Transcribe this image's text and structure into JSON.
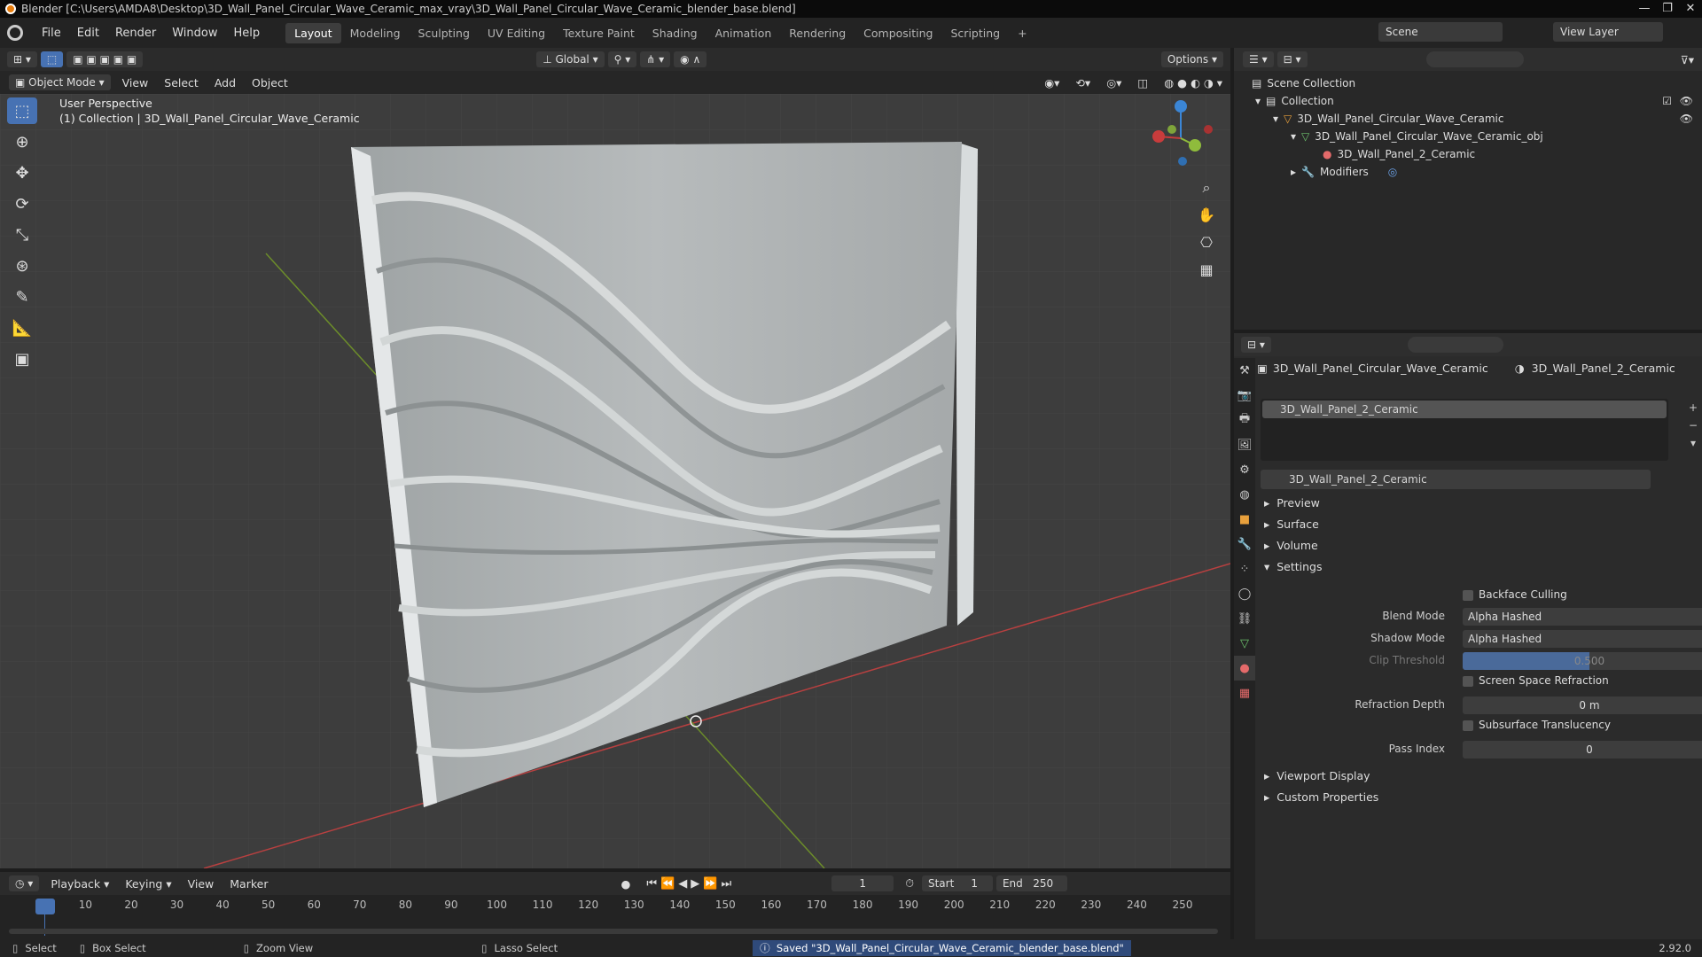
{
  "title": "Blender [C:\\Users\\AMDA8\\Desktop\\3D_Wall_Panel_Circular_Wave_Ceramic_max_vray\\3D_Wall_Panel_Circular_Wave_Ceramic_blender_base.blend]",
  "menu": [
    "File",
    "Edit",
    "Render",
    "Window",
    "Help"
  ],
  "workspaces": [
    "Layout",
    "Modeling",
    "Sculpting",
    "UV Editing",
    "Texture Paint",
    "Shading",
    "Animation",
    "Rendering",
    "Compositing",
    "Scripting"
  ],
  "add_workspace": "+",
  "scene": "Scene",
  "view_layer": "View Layer",
  "toolheader": {
    "orientation": "Global",
    "options": "Options"
  },
  "viewheader": {
    "mode": "Object Mode",
    "items": [
      "View",
      "Select",
      "Add",
      "Object"
    ]
  },
  "viewport": {
    "perspective": "User Perspective",
    "collection": "(1) Collection | 3D_Wall_Panel_Circular_Wave_Ceramic"
  },
  "outliner": {
    "rows": [
      {
        "label": "Scene Collection",
        "indent": 0
      },
      {
        "label": "Collection",
        "indent": 1
      },
      {
        "label": "3D_Wall_Panel_Circular_Wave_Ceramic",
        "indent": 2
      },
      {
        "label": "3D_Wall_Panel_Circular_Wave_Ceramic_obj",
        "indent": 3
      },
      {
        "label": "3D_Wall_Panel_2_Ceramic",
        "indent": 4
      },
      {
        "label": "Modifiers",
        "indent": 3
      }
    ]
  },
  "properties": {
    "object_name": "3D_Wall_Panel_Circular_Wave_Ceramic",
    "material_name": "3D_Wall_Panel_2_Ceramic",
    "slot": "3D_Wall_Panel_2_Ceramic",
    "material_field": "3D_Wall_Panel_2_Ceramic",
    "panels": [
      "Preview",
      "Surface",
      "Volume",
      "Settings"
    ],
    "settings": {
      "backface_culling": "Backface Culling",
      "blend_mode_label": "Blend Mode",
      "blend_mode": "Alpha Hashed",
      "shadow_mode_label": "Shadow Mode",
      "shadow_mode": "Alpha Hashed",
      "clip_threshold_label": "Clip Threshold",
      "clip_threshold": "0.500",
      "ssr": "Screen Space Refraction",
      "refraction_depth_label": "Refraction Depth",
      "refraction_depth": "0 m",
      "subsurface": "Subsurface Translucency",
      "pass_index_label": "Pass Index",
      "pass_index": "0"
    },
    "bottom_panels": [
      "Viewport Display",
      "Custom Properties"
    ]
  },
  "timeline": {
    "menus": [
      "Playback",
      "Keying",
      "View",
      "Marker"
    ],
    "current_frame": "1",
    "start_label": "Start",
    "start": "1",
    "end_label": "End",
    "end": "250",
    "ticks": [
      "1",
      "10",
      "20",
      "30",
      "40",
      "50",
      "60",
      "70",
      "80",
      "90",
      "100",
      "110",
      "120",
      "130",
      "140",
      "150",
      "160",
      "170",
      "180",
      "190",
      "200",
      "210",
      "220",
      "230",
      "240",
      "250"
    ]
  },
  "status": {
    "select": "Select",
    "box_select": "Box Select",
    "zoom_view": "Zoom View",
    "lasso_select": "Lasso Select",
    "message": "Saved \"3D_Wall_Panel_Circular_Wave_Ceramic_blender_base.blend\"",
    "version": "2.92.0"
  },
  "colors": {
    "accent": "#4772b3",
    "orange": "#e87d0d",
    "axis_x": "#c83c3c",
    "axis_y": "#8fbc3c",
    "axis_z": "#3b86d6"
  }
}
